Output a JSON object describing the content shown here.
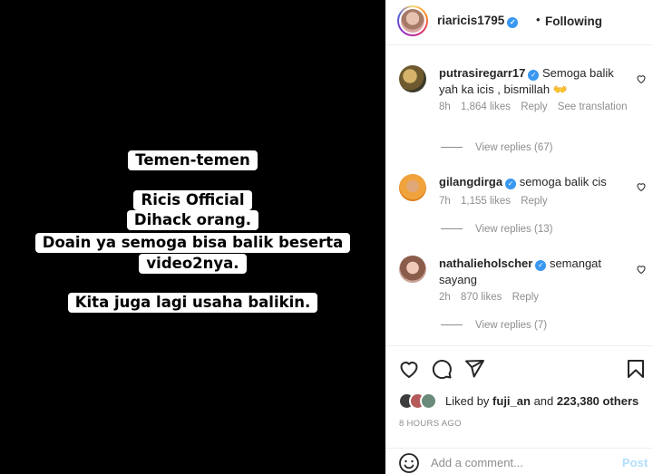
{
  "post": {
    "caption_lines": [
      "Temen-temen",
      "Ricis Official",
      "Dihack orang.",
      "Doain ya semoga bisa balik beserta",
      "video2nya.",
      "Kita juga lagi usaha balikin."
    ]
  },
  "header": {
    "username": "riaricis1795",
    "separator": "•",
    "follow_status": "Following"
  },
  "comments": [
    {
      "username": "putrasiregarr17",
      "text": "Semoga balik yah ka icis , bismillah",
      "emoji": "👐",
      "time": "8h",
      "likes": "1,864 likes",
      "reply": "Reply",
      "translate": "See translation",
      "view_replies": "View replies (67)"
    },
    {
      "username": "gilangdirga",
      "text": "semoga balik cis",
      "time": "7h",
      "likes": "1,155 likes",
      "reply": "Reply",
      "view_replies": "View replies (13)"
    },
    {
      "username": "nathalieholscher",
      "text": "semangat sayang",
      "time": "2h",
      "likes": "870 likes",
      "reply": "Reply",
      "view_replies": "View replies (7)"
    }
  ],
  "likes": {
    "prefix": "Liked by",
    "user": "fuji_an",
    "and": "and",
    "others": "223,380 others"
  },
  "timestamp": "8 HOURS AGO",
  "composer": {
    "placeholder": "Add a comment...",
    "post_label": "Post"
  },
  "icons": [
    "heart-icon",
    "comment-icon",
    "share-icon",
    "bookmark-icon",
    "emoji-icon",
    "verified-icon"
  ],
  "colors": {
    "verified": "#3897f0",
    "muted": "#8e8e8e",
    "post_disabled": "#b2dffc"
  }
}
